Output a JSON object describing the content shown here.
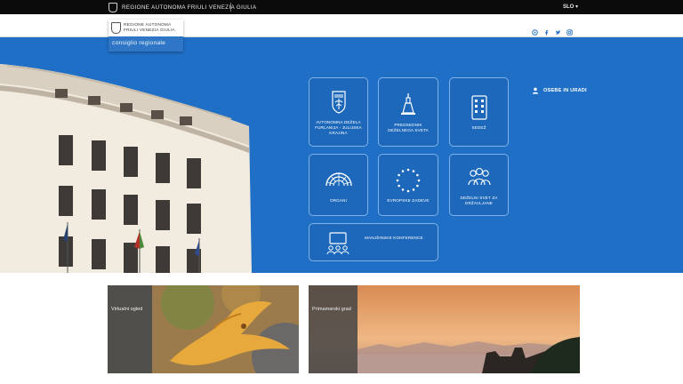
{
  "topbar": {
    "brand": "Regione Autonoma Friuli Venezia Giulia",
    "language": "SLO ▾"
  },
  "logo": {
    "line1": "Regione Autonoma",
    "line2": "Friuli Venezia Giulia",
    "subtitle": "consiglio regionale"
  },
  "social": [
    "flickr-icon",
    "facebook-icon",
    "twitter-icon",
    "instagram-icon"
  ],
  "persons_link": "Osebe in uradi",
  "tiles": [
    {
      "label": "Avtonomna Dežela Furlanija - Julijska Krajina",
      "icon": "coat-of-arms-icon"
    },
    {
      "label": "Predsednik deželnega sveta",
      "icon": "bell-icon"
    },
    {
      "label": "Sedež",
      "icon": "building-icon"
    },
    {
      "label": "Organi",
      "icon": "hemicycle-icon"
    },
    {
      "label": "Evropske zadeve",
      "icon": "eu-stars-icon"
    },
    {
      "label": "Deželni svet za državljane",
      "icon": "people-icon"
    },
    {
      "label": "Manjšinske konference",
      "icon": "conference-icon"
    }
  ],
  "cards": [
    {
      "caption": "Virtualni ogled"
    },
    {
      "caption": "Primamarski grad"
    }
  ],
  "colors": {
    "hero_blue": "#1f6fc6",
    "tile_border": "#7fb2e6",
    "topbar": "#0b0b0b"
  }
}
